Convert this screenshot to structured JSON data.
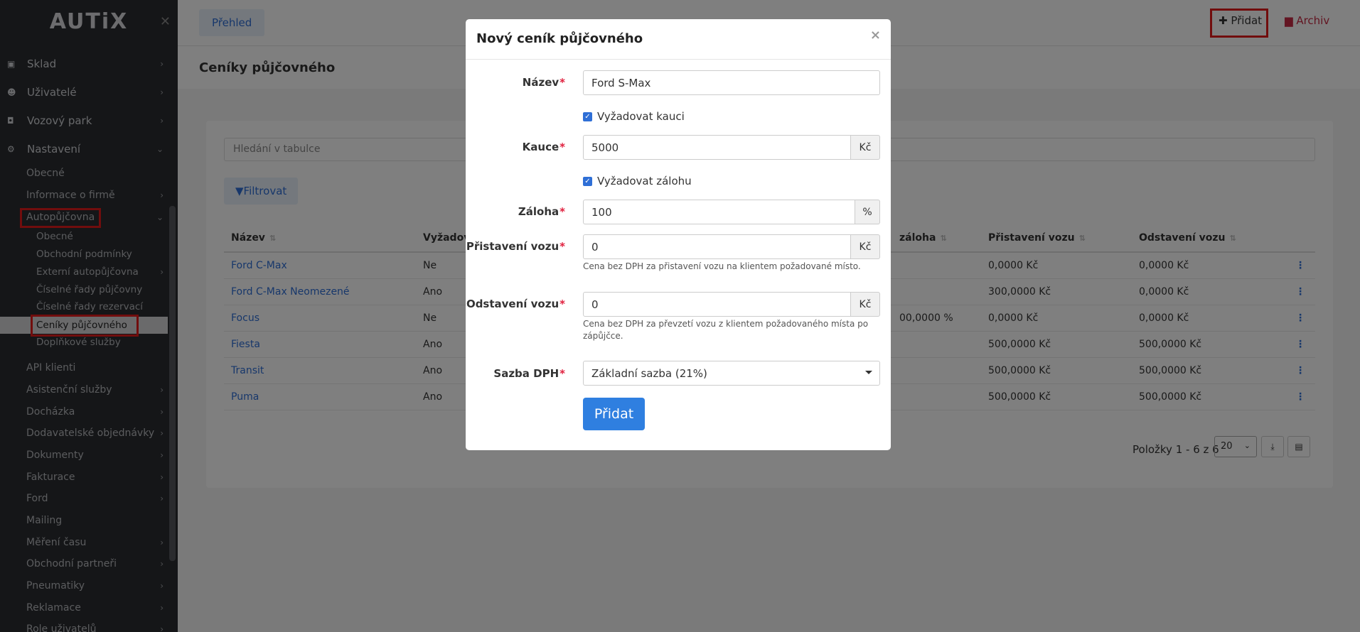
{
  "app": {
    "logo": "AUTiX"
  },
  "sidebar": {
    "top_items": [
      {
        "label": "Sklad",
        "icon": "box-icon"
      },
      {
        "label": "Uživatelé",
        "icon": "users-icon"
      },
      {
        "label": "Vozový park",
        "icon": "car-icon"
      },
      {
        "label": "Nastavení",
        "icon": "gears-icon"
      }
    ],
    "settings_items": [
      "Obecné",
      "Informace o firmě",
      "Autopůjčovna"
    ],
    "rental_items": [
      "Obecné",
      "Obchodní podmínky",
      "Externí autopůjčovna",
      "Číselné řady půjčovny",
      "Číselné řady rezervací",
      "Ceníky půjčovného",
      "Doplňkové služby"
    ],
    "more_items": [
      "API klienti",
      "Asistenční služby",
      "Docházka",
      "Dodavatelské objednávky",
      "Dokumenty",
      "Fakturace",
      "Ford",
      "Mailing",
      "Měření času",
      "Obchodní partneři",
      "Pneumatiky",
      "Reklamace",
      "Role uživatelů"
    ]
  },
  "header": {
    "prehled": "Přehled",
    "pridat": "Přidat",
    "archiv": "Archiv"
  },
  "page": {
    "title": "Ceníky půjčovného"
  },
  "table": {
    "search_placeholder": "Hledání v tabulce",
    "filter": "Filtrovat",
    "headers": [
      "Název",
      "Vyžadov",
      "záloha",
      "Přistavení vozu",
      "Odstavení vozu"
    ],
    "rows": [
      {
        "name": "Ford C-Max",
        "req": "Ne",
        "zaloha": "",
        "prist": "0,0000 Kč",
        "odst": "0,0000 Kč"
      },
      {
        "name": "Ford C-Max Neomezené",
        "req": "Ano",
        "zaloha": "",
        "prist": "300,0000 Kč",
        "odst": "0,0000 Kč"
      },
      {
        "name": "Focus",
        "req": "Ne",
        "zaloha": "00,0000 %",
        "prist": "0,0000 Kč",
        "odst": "0,0000 Kč"
      },
      {
        "name": "Fiesta",
        "req": "Ano",
        "zaloha": "",
        "prist": "500,0000 Kč",
        "odst": "500,0000 Kč"
      },
      {
        "name": "Transit",
        "req": "Ano",
        "zaloha": "",
        "prist": "500,0000 Kč",
        "odst": "500,0000 Kč"
      },
      {
        "name": "Puma",
        "req": "Ano",
        "zaloha": "",
        "prist": "500,0000 Kč",
        "odst": "500,0000 Kč"
      }
    ],
    "pager_text": "Položky 1 - 6 z 6",
    "page_size": "20"
  },
  "modal": {
    "title": "Nový ceník půjčovného",
    "name_label": "Název",
    "name_value": "Ford S-Max",
    "deposit_check": "Vyžadovat kauci",
    "deposit_label": "Kauce",
    "deposit_value": "5000",
    "currency": "Kč",
    "advance_check": "Vyžadovat zálohu",
    "advance_label": "Záloha",
    "advance_value": "100",
    "percent": "%",
    "delivery_label": "Přistavení vozu",
    "delivery_value": "0",
    "delivery_help": "Cena bez DPH za přistavení vozu na klientem požadované místo.",
    "pickup_label": "Odstavení vozu",
    "pickup_value": "0",
    "pickup_help": "Cena bez DPH za převzetí vozu z klientem požadovaného místa po zápůjčce.",
    "vat_label": "Sazba DPH",
    "vat_value": "Základní sazba (21%)",
    "submit": "Přidat",
    "required_mark": "*"
  },
  "colors": {
    "accent": "#2f7fe0",
    "sidebar_bg": "#2b2d31",
    "highlight": "#e21b1b",
    "archive": "#c62a44"
  }
}
